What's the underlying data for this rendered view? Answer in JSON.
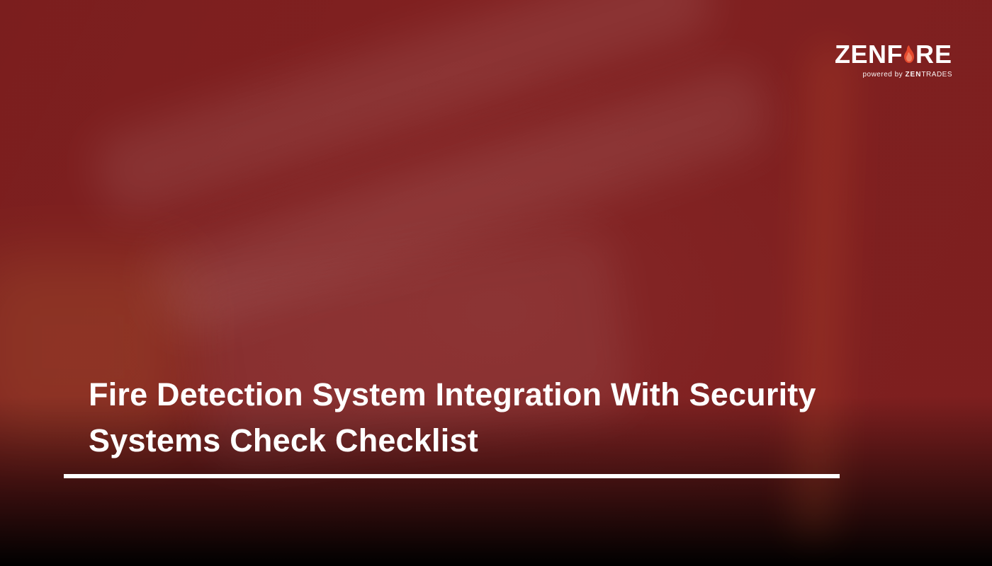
{
  "brand": {
    "name_part1": "ZENF",
    "name_part2": "RE",
    "icon": "flame-icon",
    "tagline_prefix": "powered by ",
    "tagline_brand_bold": "ZEN",
    "tagline_brand_rest": "TRADES"
  },
  "hero": {
    "title": "Fire Detection System Integration With Security Systems Check Checklist"
  },
  "colors": {
    "overlay": "#821e1e",
    "text": "#ffffff",
    "flame": "#e64a2e"
  }
}
